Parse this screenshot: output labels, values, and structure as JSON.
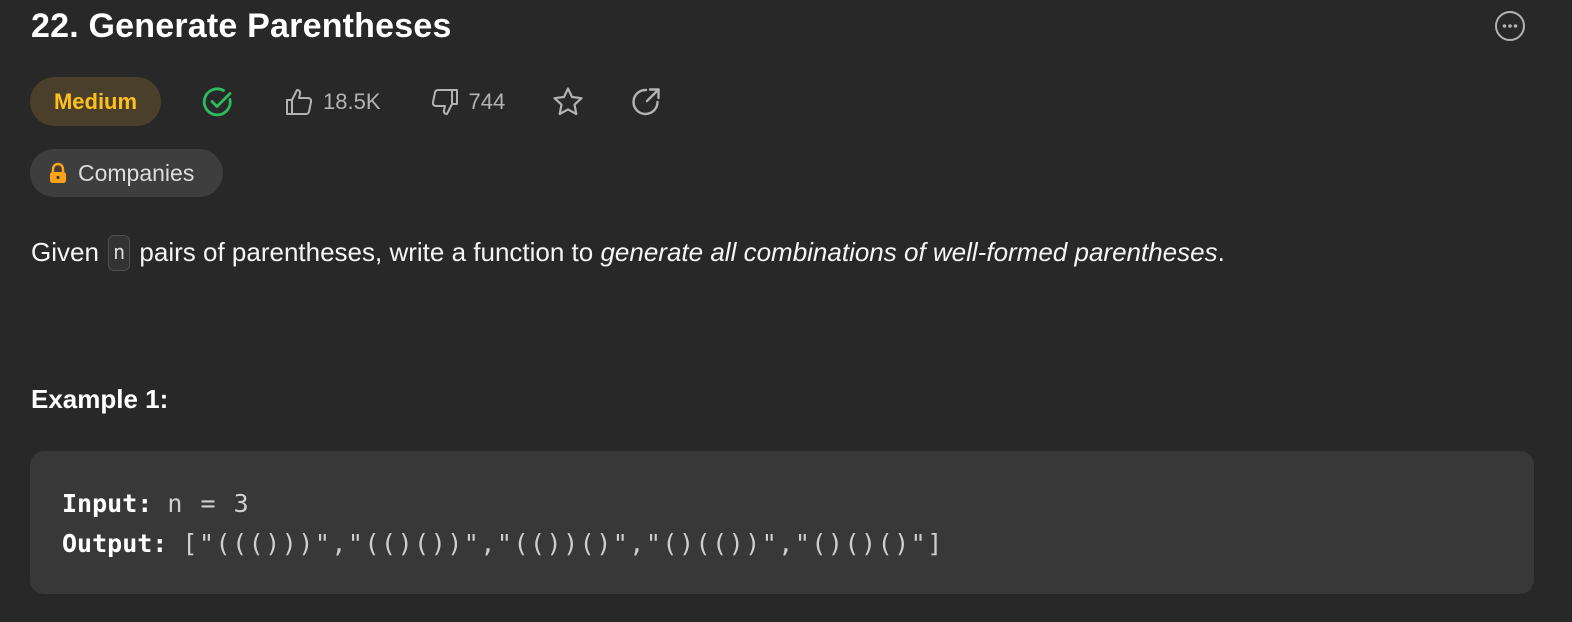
{
  "problem": {
    "title": "22. Generate Parentheses",
    "difficulty": "Medium",
    "likes": "18.5K",
    "dislikes": "744",
    "companies_label": "Companies"
  },
  "description": {
    "prefix": "Given ",
    "code_n": "n",
    "middle": " pairs of parentheses, write a function to ",
    "emphasis": "generate all combinations of well-formed parentheses",
    "suffix": "."
  },
  "example": {
    "heading": "Example 1:",
    "input_label": "Input:",
    "input_value": "n = 3",
    "output_label": "Output:",
    "output_value": "[\"((()))\",\"(()())\",\"(())()\",\"()(())\",\"()()()\"]"
  },
  "icons": {
    "more": "more-horizontal-icon",
    "solved": "check-circle-icon",
    "like": "thumbs-up-icon",
    "dislike": "thumbs-down-icon",
    "favorite": "star-icon",
    "share": "share-icon",
    "lock": "lock-icon"
  },
  "colors": {
    "background": "#282828",
    "difficulty_medium": "#ffc01e",
    "solved_green": "#2cbb5d",
    "lock_orange": "#ffa116"
  }
}
